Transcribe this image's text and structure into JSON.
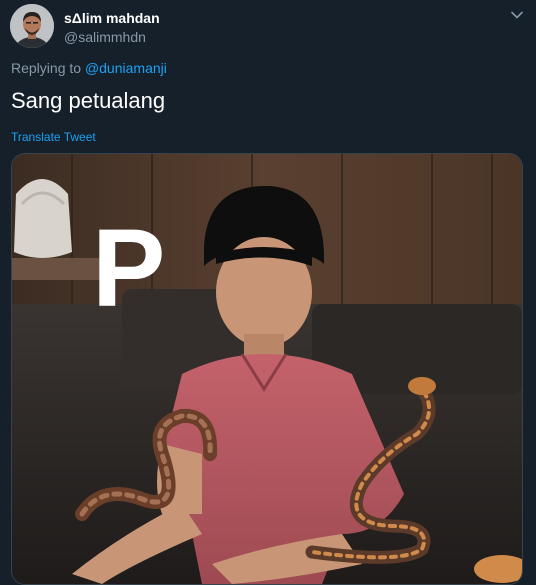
{
  "author": {
    "display_name": "sΔlim mahdan",
    "handle": "@salimmhdn",
    "avatar_icon": "avatar-photo"
  },
  "reply": {
    "prefix": "Replying to",
    "mention": "@duniamanji"
  },
  "tweet": {
    "text": "Sang petualang",
    "translate_label": "Translate Tweet"
  },
  "media": {
    "overlay_letter": "P",
    "description_icon": "photo"
  },
  "colors": {
    "background": "#15202b",
    "link": "#1da1f2",
    "secondary_text": "#8899a6",
    "border": "#38444d"
  }
}
